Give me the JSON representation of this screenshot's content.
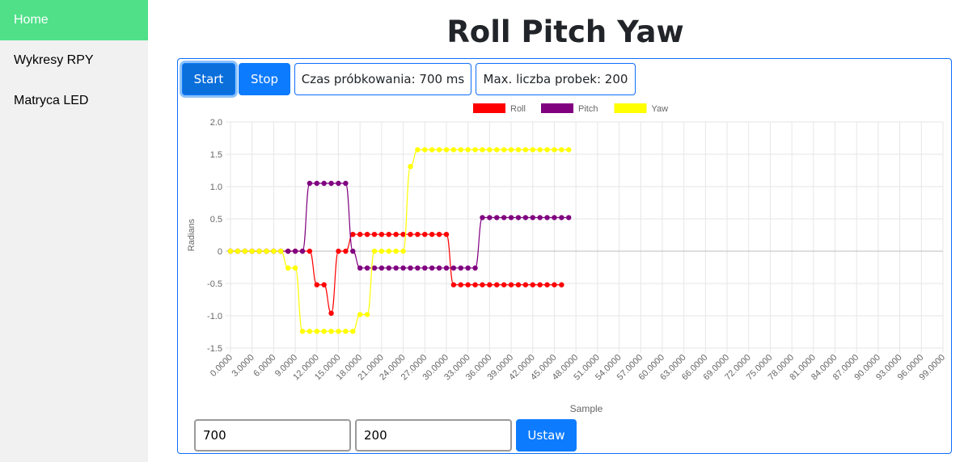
{
  "sidebar": {
    "items": [
      {
        "label": "Home",
        "active": true
      },
      {
        "label": "Wykresy RPY",
        "active": false
      },
      {
        "label": "Matryca LED",
        "active": false
      }
    ]
  },
  "page": {
    "title": "Roll Pitch Yaw"
  },
  "toolbar": {
    "start_label": "Start",
    "stop_label": "Stop",
    "sampling_label": "Czas próbkowania: 700 ms",
    "max_samples_label": "Max. liczba probek: 200"
  },
  "form": {
    "sampling_value": "700",
    "max_samples_value": "200",
    "submit_label": "Ustaw"
  },
  "colors": {
    "accent": "#0d7bfd",
    "sidebar_active": "#4fe088"
  },
  "chart_data": {
    "type": "line",
    "xlabel": "Sample",
    "ylabel": "Radians",
    "ylim": [
      -1.5,
      2.0
    ],
    "yticks": [
      "2.0",
      "1.5",
      "1.0",
      "0.5",
      "0",
      "-0.5",
      "-1.0",
      "-1.5"
    ],
    "x_tick_labels": [
      "0.0000",
      "3.0000",
      "6.0000",
      "9.0000",
      "12.0000",
      "15.0000",
      "18.0000",
      "21.0000",
      "24.0000",
      "27.0000",
      "30.0000",
      "33.0000",
      "36.0000",
      "39.0000",
      "42.0000",
      "45.0000",
      "48.0000",
      "51.0000",
      "54.0000",
      "57.0000",
      "60.0000",
      "63.0000",
      "66.0000",
      "69.0000",
      "72.0000",
      "75.0000",
      "78.0000",
      "81.0000",
      "84.0000",
      "87.0000",
      "90.0000",
      "93.0000",
      "96.0000",
      "99.0000"
    ],
    "x_step": 1,
    "grid": true,
    "legend_position": "top-center",
    "series": [
      {
        "name": "Roll",
        "color": "#ff0000",
        "values": [
          0,
          0,
          0,
          0,
          0,
          0,
          0,
          0,
          0,
          0,
          0,
          0,
          -0.52,
          -0.52,
          -0.96,
          0,
          0,
          0.26,
          0.26,
          0.26,
          0.26,
          0.26,
          0.26,
          0.26,
          0.26,
          0.26,
          0.26,
          0.26,
          0.26,
          0.26,
          0.26,
          -0.52,
          -0.52,
          -0.52,
          -0.52,
          -0.52,
          -0.52,
          -0.52,
          -0.52,
          -0.52,
          -0.52,
          -0.52,
          -0.52,
          -0.52,
          -0.52,
          -0.52,
          -0.52
        ]
      },
      {
        "name": "Pitch",
        "color": "#800080",
        "values": [
          0,
          0,
          0,
          0,
          0,
          0,
          0,
          0,
          0,
          0,
          0,
          1.05,
          1.05,
          1.05,
          1.05,
          1.05,
          1.05,
          0,
          -0.26,
          -0.26,
          -0.26,
          -0.26,
          -0.26,
          -0.26,
          -0.26,
          -0.26,
          -0.26,
          -0.26,
          -0.26,
          -0.26,
          -0.26,
          -0.26,
          -0.26,
          -0.26,
          -0.26,
          0.52,
          0.52,
          0.52,
          0.52,
          0.52,
          0.52,
          0.52,
          0.52,
          0.52,
          0.52,
          0.52,
          0.52,
          0.52
        ]
      },
      {
        "name": "Yaw",
        "color": "#ffff00",
        "values": [
          0,
          0,
          0,
          0,
          0,
          0,
          0,
          0,
          -0.26,
          -0.26,
          -1.24,
          -1.24,
          -1.24,
          -1.24,
          -1.24,
          -1.24,
          -1.24,
          -1.24,
          -0.98,
          -0.98,
          0,
          0,
          0,
          0,
          0,
          1.31,
          1.57,
          1.57,
          1.57,
          1.57,
          1.57,
          1.57,
          1.57,
          1.57,
          1.57,
          1.57,
          1.57,
          1.57,
          1.57,
          1.57,
          1.57,
          1.57,
          1.57,
          1.57,
          1.57,
          1.57,
          1.57,
          1.57
        ]
      }
    ]
  }
}
